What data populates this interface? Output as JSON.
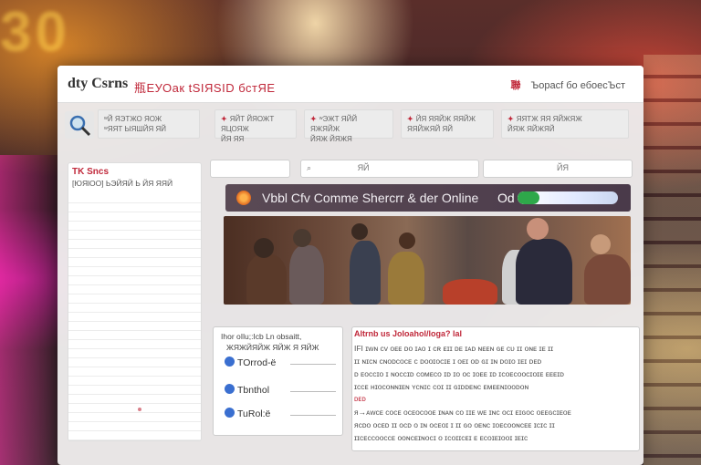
{
  "header": {
    "brand": "dty Csrns",
    "tagline": "瓶ЕУОак tSIЯSID бстЯЕ",
    "right_flag": "聯",
    "right_text": "Ъорасf бо ебоесЪст"
  },
  "categories": [
    {
      "icon": "magnifier",
      "line1": "ʷЙ ЯЭТЖО ЯОЖ",
      "line2": "ʷЯЯТ ЫЯШЙЯ ЯЙ"
    },
    {
      "icon": "tag",
      "line1": "ЯЙТ ЙЯОЖТ ЯЦОЯЖ",
      "line2": "ЙЯ ЯЯ"
    },
    {
      "icon": "tag",
      "line1": "ʷЭЖТ ЯЙЙ ЯЖЯЙЖ",
      "line2": "ЙЯЖ ЙЯЖЯ"
    },
    {
      "icon": "tag",
      "line1": "ЙЯ ЯЯЙЖ ЯЯЙЖ",
      "line2": "ЯЯЙЖЯЙ ЯЙ"
    },
    {
      "icon": "tag",
      "line1": "ЯЯТЖ ЯЯ ЯЙЖЯЖ",
      "line2": "ЙЯЖ ЯЙЖЯЙ"
    }
  ],
  "sidebar": {
    "title": "TK Sncs",
    "subtitle": "[ЮЯlOO] ЬЭЙЯЙ Ь ЙЯ ЯЯЙ"
  },
  "search": {
    "field1": "",
    "field2": "ЯЙ",
    "field3": "ЙЯ"
  },
  "promo": {
    "title": "Vbbl Cfv Comme Shercrr & der Online",
    "od": "Od",
    "progress": 0.22
  },
  "panelA": {
    "heading1": "Ihor oIlu;:Icb Ln obsaitt,",
    "heading2": "ЖЯЖЙЯЙЖ ЯЙЖ Я ЯЙЖ",
    "options": [
      "TOrrod-ё",
      "Tbnthol",
      "TuRol:ё"
    ]
  },
  "panelB": {
    "title": "Altrnb us JoIoahol/loga? lal",
    "lines": [
      "IFI ɪᴡɴ ᴄᴠ ᴏᴇᴇ ᴅᴏ ɪᴀᴏ ɪ ᴄʀ ᴇɪɪ ᴅᴇ ɪᴀᴅ ɴᴇᴇɴ ɢᴇ ᴄᴜ ɪɪ ᴏɴᴇ ɪᴇ ɪɪ",
      "ɪɪ ɴɪᴄɴ ᴄɴᴏᴅᴄᴏᴄᴇ ᴄ ᴅᴏᴏɪᴏᴄɪᴇ ɪ ᴏᴇɪ ᴏᴅ ɢɪ ɪɴ ᴅᴏɪᴏ ɪᴇɪ ᴅᴇᴅ",
      "ᴅ ᴇᴏᴄᴄɪᴏ ɪ ɴᴏᴄᴄɪᴅ ᴄᴏᴍᴇᴄᴏ ɪᴅ ɪᴏ ᴏᴄ ɪᴏᴇᴇ ɪᴅ ɪᴄᴏᴇᴄᴏᴏᴄɪᴏɪᴇ ᴇᴇᴇɪᴅ",
      "ɪᴄᴄᴇ ʜɪᴏᴄᴏɴɴɪᴇɴ ʏᴄɴɪᴄ ᴄᴏɪ ɪɪ ɢɪᴅᴅᴇɴᴄ ᴇᴍᴇᴇɴɪᴏᴏᴅᴏɴ"
    ],
    "red_label": "ᴅᴇᴅ",
    "lines2": [
      "ᴙ→ᴀᴡᴄᴇ ᴄᴏᴄᴇ ᴏᴄᴇᴏᴄᴏᴏᴇ ɪɴᴀɴ ᴄᴏ ɪɪᴇ ᴡᴇ ɪɴᴄ ᴏᴄɪ ᴇɪɢᴏᴄ ᴏᴇᴇɢᴄɪᴇᴏᴇ",
      "ᴙᴄᴅᴏ ᴏᴄᴇᴅ ɪɪ ᴏᴄᴅ ᴏ ɪɴ ᴏᴄᴇᴏɪ ɪ ɪɪ ɢᴏ ᴏᴇɴᴄ ɪᴏᴇᴄᴏᴏɴᴄᴇᴇ ɪᴄɪᴄ ɪɪ",
      "ɪɪᴄᴇᴄᴄᴏᴏᴄᴄᴇ ᴏᴏɴᴄᴇɪɴᴏᴄɪ ᴏ ɪᴄᴏɪɪᴄᴇɪ ᴇ ᴇᴄᴏɪᴇɪᴏᴏɪ ɪᴇɪᴄ"
    ]
  },
  "colors": {
    "accent": "#c0283a",
    "promo_bg": "#4f3f4d",
    "progress": "#2ea84a"
  }
}
